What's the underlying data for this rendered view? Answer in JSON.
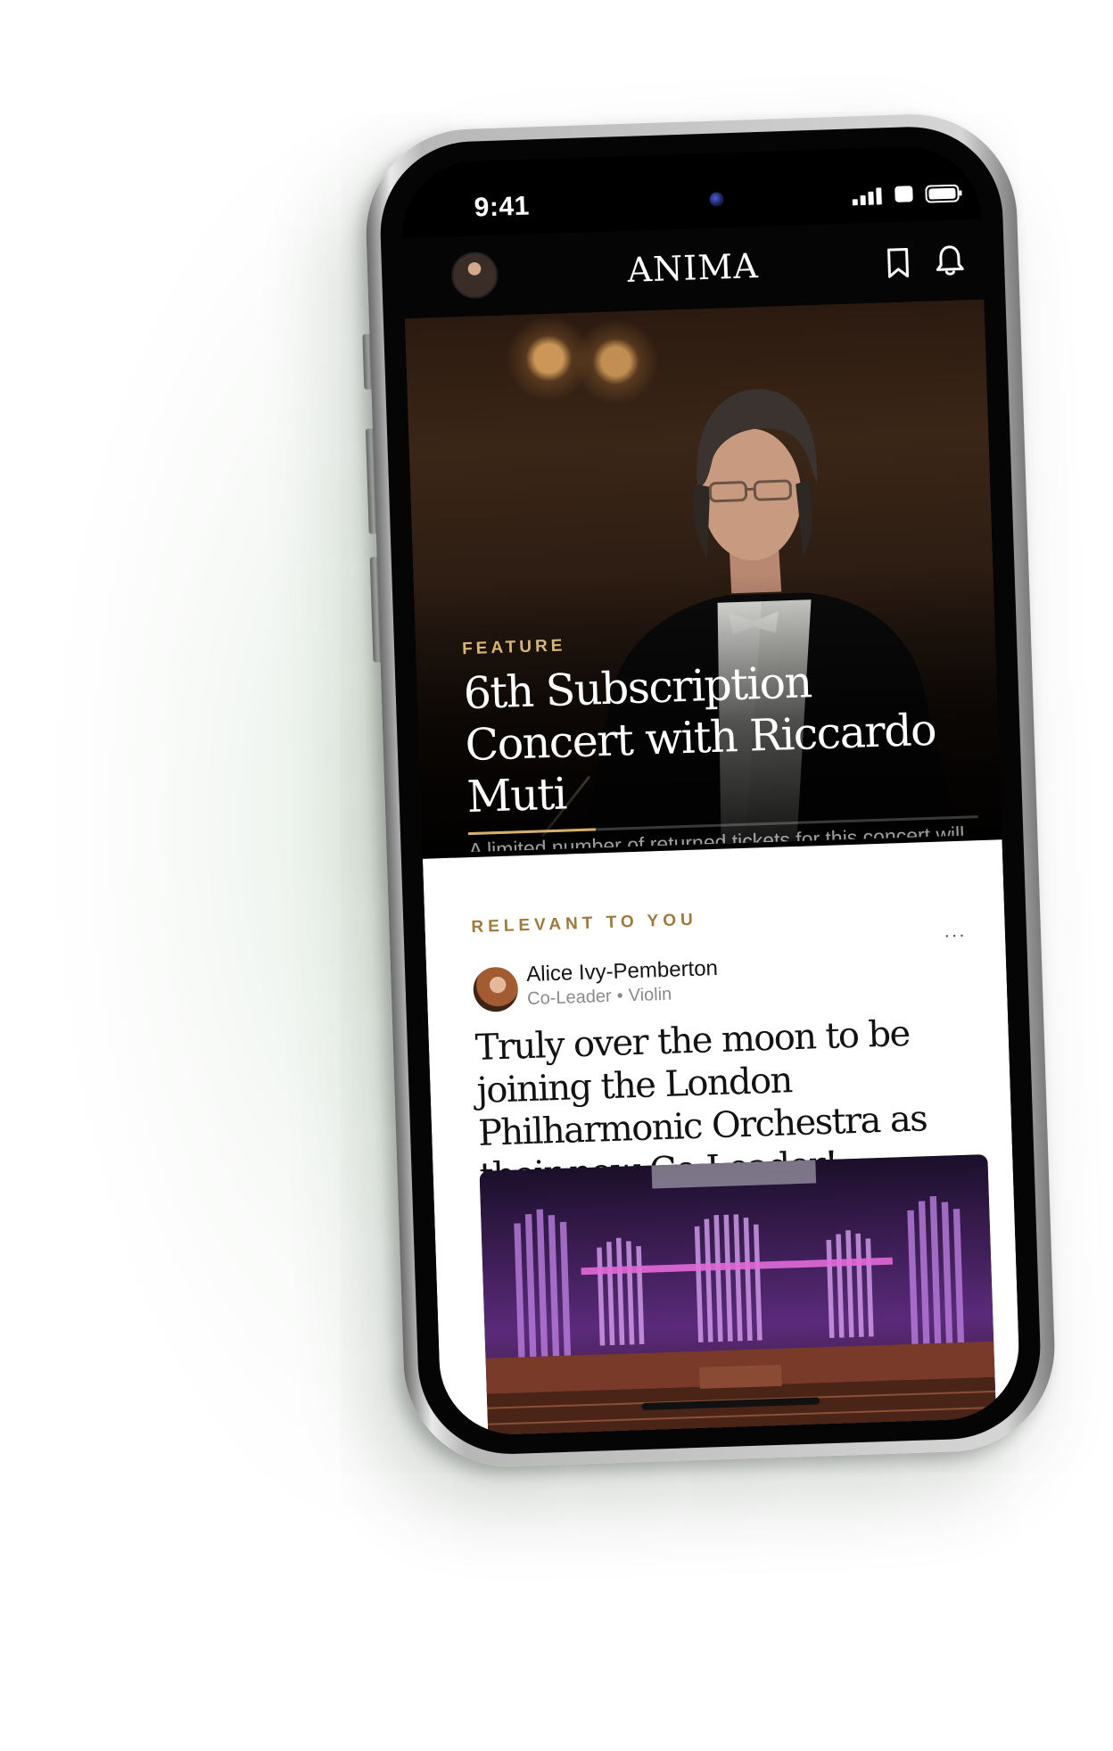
{
  "status_bar": {
    "time": "9:41"
  },
  "app_bar": {
    "logo": "ANIMA",
    "icons": [
      "profile-avatar",
      "bookmark-icon",
      "bell-icon"
    ]
  },
  "feature": {
    "kicker": "FEATURE",
    "title": "6th Subscription Concert with Riccardo Muti",
    "description": "A limited number of returned tickets for this concert will become available beginning on",
    "progress": 0.25
  },
  "relevant": {
    "section_label": "RELEVANT TO YOU",
    "more_label": "···",
    "author": {
      "name": "Alice Ivy-Pemberton",
      "role": "Co-Leader",
      "separator": "•",
      "instrument": "Violin"
    },
    "post_title": "Truly over the moon to be joining the London Philharmonic Orchestra as their new Co-Leader!"
  },
  "colors": {
    "accent_gold": "#d8b774",
    "section_gold": "#9f7a3c",
    "card_bg": "#ffffff",
    "app_bg": "#050505"
  }
}
